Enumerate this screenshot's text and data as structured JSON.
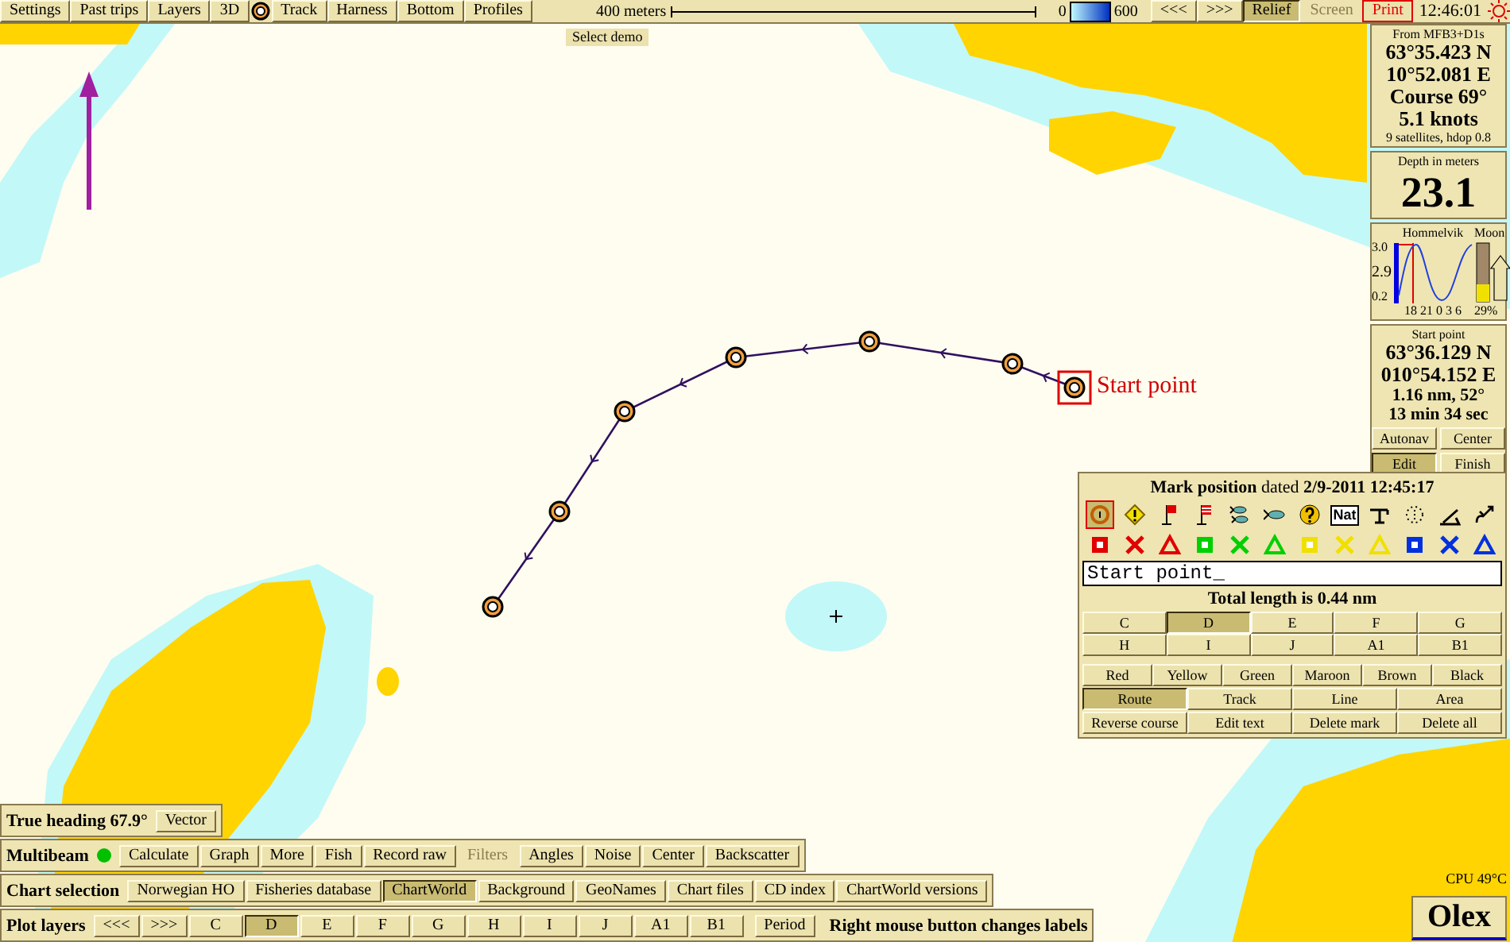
{
  "top_bar": {
    "menu": [
      {
        "kind": "button",
        "label": "Settings"
      },
      {
        "kind": "button",
        "label": "Past trips"
      },
      {
        "kind": "button",
        "label": "Layers"
      },
      {
        "kind": "button",
        "label": "3D"
      },
      {
        "kind": "icon"
      },
      {
        "kind": "button",
        "label": "Track"
      },
      {
        "kind": "button",
        "label": "Harness"
      },
      {
        "kind": "button",
        "label": "Bottom"
      },
      {
        "kind": "button",
        "label": "Profiles"
      }
    ],
    "scale_label": "400 meters",
    "depth_legend": {
      "min": "0",
      "max": "600"
    },
    "nav": [
      "<<<",
      ">>>"
    ],
    "relief": {
      "label": "Relief",
      "selected": true
    },
    "screen": {
      "label": "Screen",
      "disabled": true
    },
    "print": "Print",
    "clock": "12:46:01"
  },
  "map": {
    "demo_label": "Select demo",
    "route_label": "Start point"
  },
  "position": {
    "source": "From MFB3+D1s",
    "lat": "63°35.423 N",
    "lon": "10°52.081 E",
    "course": "Course 69°",
    "speed": "5.1 knots",
    "satellites": "9 satellites, hdop 0.8"
  },
  "depth": {
    "title": "Depth in meters",
    "value": "23.1"
  },
  "tide": {
    "place": "Hommelvik",
    "moon": "Moon",
    "high": "3.0",
    "now": "2.9",
    "low": "0.2",
    "hours": "18 21 0 3 6",
    "moon_phase": "29%"
  },
  "start_point": {
    "title": "Start point",
    "lat": "63°36.129 N",
    "lon": "010°54.152 E",
    "distance": "1.16 nm, 52°",
    "time": "13 min 34 sec",
    "buttons": [
      {
        "label": "Autonav",
        "selected": false
      },
      {
        "label": "Center",
        "selected": false
      },
      {
        "label": "Edit",
        "selected": true
      },
      {
        "label": "Finish",
        "selected": false
      }
    ]
  },
  "mark_panel": {
    "title": "**Mark position** dated **2/9-2011 12:45:17**",
    "symbols_top": [
      {
        "kind": "target",
        "selected": true
      },
      {
        "kind": "diamond",
        "selected": false
      },
      {
        "kind": "flag",
        "selected": false
      },
      {
        "kind": "striped-flag",
        "selected": false
      },
      {
        "kind": "fishes",
        "selected": false
      },
      {
        "kind": "fish",
        "selected": false
      },
      {
        "kind": "question",
        "selected": false
      },
      {
        "kind": "text",
        "label": "Nat",
        "selected": false
      },
      {
        "kind": "crane",
        "selected": false
      },
      {
        "kind": "dotted-ring",
        "selected": false
      },
      {
        "kind": "slope",
        "selected": false
      },
      {
        "kind": "hook",
        "selected": false
      }
    ],
    "symbols_bottom": [
      {
        "kind": "square",
        "color": "#e00000",
        "selected": false
      },
      {
        "kind": "cross",
        "color": "#e00000",
        "selected": false
      },
      {
        "kind": "triangle",
        "color": "#e00000",
        "selected": false
      },
      {
        "kind": "square",
        "color": "#00d000",
        "selected": false
      },
      {
        "kind": "cross",
        "color": "#00d000",
        "selected": false
      },
      {
        "kind": "triangle",
        "color": "#00d000",
        "selected": false
      },
      {
        "kind": "square",
        "color": "#f0e000",
        "selected": false
      },
      {
        "kind": "cross",
        "color": "#f0e000",
        "selected": false
      },
      {
        "kind": "triangle",
        "color": "#f0e000",
        "selected": false
      },
      {
        "kind": "square",
        "color": "#0030e0",
        "selected": false
      },
      {
        "kind": "cross",
        "color": "#0030e0",
        "selected": false
      },
      {
        "kind": "triangle",
        "color": "#0030e0",
        "selected": false
      }
    ],
    "name_value": "Start point_",
    "total": "Total length is 0.44 nm",
    "layers": [
      {
        "label": "C",
        "selected": false
      },
      {
        "label": "D",
        "selected": true
      },
      {
        "label": "E",
        "selected": false
      },
      {
        "label": "F",
        "selected": false
      },
      {
        "label": "G",
        "selected": false
      },
      {
        "label": "H",
        "selected": false
      },
      {
        "label": "I",
        "selected": false
      },
      {
        "label": "J",
        "selected": false
      },
      {
        "label": "A1",
        "selected": false
      },
      {
        "label": "B1",
        "selected": false
      }
    ],
    "colors": [
      {
        "label": "Red",
        "selected": false
      },
      {
        "label": "Yellow",
        "selected": false
      },
      {
        "label": "Green",
        "selected": false
      },
      {
        "label": "Maroon",
        "selected": false
      },
      {
        "label": "Brown",
        "selected": false
      },
      {
        "label": "Black",
        "selected": false
      }
    ],
    "modes": [
      {
        "label": "Route",
        "selected": true
      },
      {
        "label": "Track",
        "selected": false
      },
      {
        "label": "Line",
        "selected": false
      },
      {
        "label": "Area",
        "selected": false
      }
    ],
    "actions": [
      "Reverse course",
      "Edit text",
      "Delete mark",
      "Delete all"
    ]
  },
  "heading_bar": {
    "label": "True heading 67.9°",
    "button": "Vector"
  },
  "multibeam_bar": {
    "label": "Multibeam",
    "indicator": {
      "color": "#00c000"
    },
    "buttons": [
      {
        "label": "Calculate",
        "disabled": false
      },
      {
        "label": "Graph",
        "disabled": false
      },
      {
        "label": "More",
        "disabled": false
      },
      {
        "label": "Fish",
        "disabled": false
      },
      {
        "label": "Record raw",
        "disabled": false
      },
      {
        "label": "Filters",
        "disabled": true
      },
      {
        "label": "Angles",
        "disabled": false
      },
      {
        "label": "Noise",
        "disabled": false
      },
      {
        "label": "Center",
        "disabled": false
      },
      {
        "label": "Backscatter",
        "disabled": false
      }
    ]
  },
  "chart_bar": {
    "label": "Chart selection",
    "buttons": [
      {
        "label": "Norwegian HO",
        "selected": false
      },
      {
        "label": "Fisheries database",
        "selected": false
      },
      {
        "label": "ChartWorld",
        "selected": true
      },
      {
        "label": "Background",
        "selected": false
      },
      {
        "label": "GeoNames",
        "selected": false
      },
      {
        "label": "Chart files",
        "selected": false
      },
      {
        "label": "CD index",
        "selected": false
      },
      {
        "label": "ChartWorld versions",
        "selected": false
      }
    ]
  },
  "plot_bar": {
    "label": "Plot layers",
    "nav": [
      "<<<",
      ">>>"
    ],
    "layers": [
      {
        "label": "C",
        "selected": false
      },
      {
        "label": "D",
        "selected": true
      },
      {
        "label": "E",
        "selected": false
      },
      {
        "label": "F",
        "selected": false
      },
      {
        "label": "G",
        "selected": false
      },
      {
        "label": "H",
        "selected": false
      },
      {
        "label": "I",
        "selected": false
      },
      {
        "label": "J",
        "selected": false
      },
      {
        "label": "A1",
        "selected": false
      },
      {
        "label": "B1",
        "selected": false
      }
    ],
    "period": "Period",
    "hint": "Right mouse button changes labels"
  },
  "cpu": "CPU 49°C",
  "logo": "Olex"
}
